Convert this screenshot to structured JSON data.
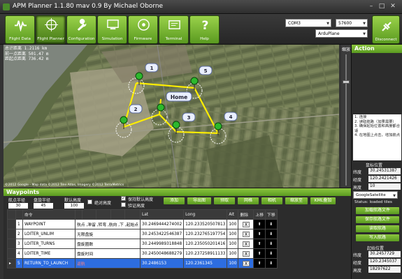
{
  "window": {
    "title": "APM Planner 1.1.80 mav 0.9 By Michael Oborne"
  },
  "toolbar": {
    "buttons": [
      {
        "label": "Flight Data"
      },
      {
        "label": "Flight Planner"
      },
      {
        "label": "Configuration"
      },
      {
        "label": "Simulation"
      },
      {
        "label": "Firmware"
      },
      {
        "label": "Terminal"
      },
      {
        "label": "Help"
      }
    ],
    "port": "COM3",
    "baud": "57600",
    "vehicle": "ArduPlane",
    "disconnect_label": "Disconnect"
  },
  "map": {
    "hud": [
      {
        "label": "Total distance",
        "text": "总计距离",
        "value": "1.2116 km"
      },
      {
        "label": "Previous",
        "text": "前一点距离",
        "value": "501.47 m"
      },
      {
        "label": "Home distance",
        "text": "距起点距离",
        "value": "736.42 m"
      }
    ],
    "copyright": "©2012 Google - Map data ©2012 Tele Atlas, Imagery ©2012 TerraMetrics",
    "waypoints": [
      "1",
      "2",
      "3",
      "4",
      "5"
    ],
    "home_label": "Home",
    "zoom_label": "缩放"
  },
  "action": {
    "title": "Action",
    "notes": "1. 连接\n2. 读取航路（如果需要）\n3. 确保起始位置和高度都合适\n4. 在地图上点击，增加航点",
    "mouse_header": "鼠标位置",
    "mouse": {
      "lat_label": "纬度",
      "lat": "30.24531387",
      "lng_label": "经度",
      "lng": "120.2421426",
      "alt_label": "高度",
      "alt": "10"
    },
    "map_source": "GoogleSatellite",
    "status": "Status: loaded tiles",
    "buttons": [
      "加载航路文件",
      "保存航路文件",
      "读取航路",
      "写入航路"
    ],
    "home_header": "起始位置",
    "home": {
      "lat_label": "纬度",
      "lat": "30.2457729",
      "lng_label": "经度",
      "lng": "120.2345037",
      "alt_label": "高度",
      "alt": "18297622"
    }
  },
  "waypoints_panel": {
    "title": "Waypoints",
    "radius_label": "航点半径",
    "radius": "30",
    "loiter_label": "盘旋半径",
    "loiter": "45",
    "default_alt_label": "默认高度",
    "default_alt": "100",
    "absolute_alt_label": "绝对高度",
    "hold_alt_label": "保持默认高度",
    "verify_height_label": "验证高度",
    "buttons": [
      "添加",
      "导出图",
      "预取",
      "网格",
      "相机",
      "缩放至",
      "KML叠加"
    ],
    "columns": [
      "命令",
      "",
      "",
      "",
      "",
      "",
      "Lat",
      "Long",
      "Alt",
      "删除",
      "上移",
      "下移"
    ],
    "rows": [
      {
        "num": "1",
        "cmd": "WAYPOINT",
        "note": "航点 ,滞留 ,转弯 ,航向 ,下 ,起始点",
        "lat": "30.2469444274002",
        "lng": "120.233520507813",
        "alt": "100"
      },
      {
        "num": "2",
        "cmd": "LOITER_UNLIM",
        "note": "无限盘旋",
        "lat": "30.2453422546387",
        "lng": "120.232765197754",
        "alt": "100"
      },
      {
        "num": "3",
        "cmd": "LOITER_TURNS",
        "note": "盘旋圈数",
        "lat": "30.2449989318848",
        "lng": "120.235050201416",
        "alt": "100"
      },
      {
        "num": "4",
        "cmd": "LOITER_TIME",
        "note": "盘旋时间",
        "lat": "30.2450048688279",
        "lng": "120.237258911133",
        "alt": "100"
      },
      {
        "num": "5",
        "cmd": "RETURN_TO_LAUNCH",
        "note": "返航",
        "lat": "30.2486153",
        "lng": "120.2361345",
        "alt": "100"
      }
    ],
    "delete_label": "X"
  }
}
